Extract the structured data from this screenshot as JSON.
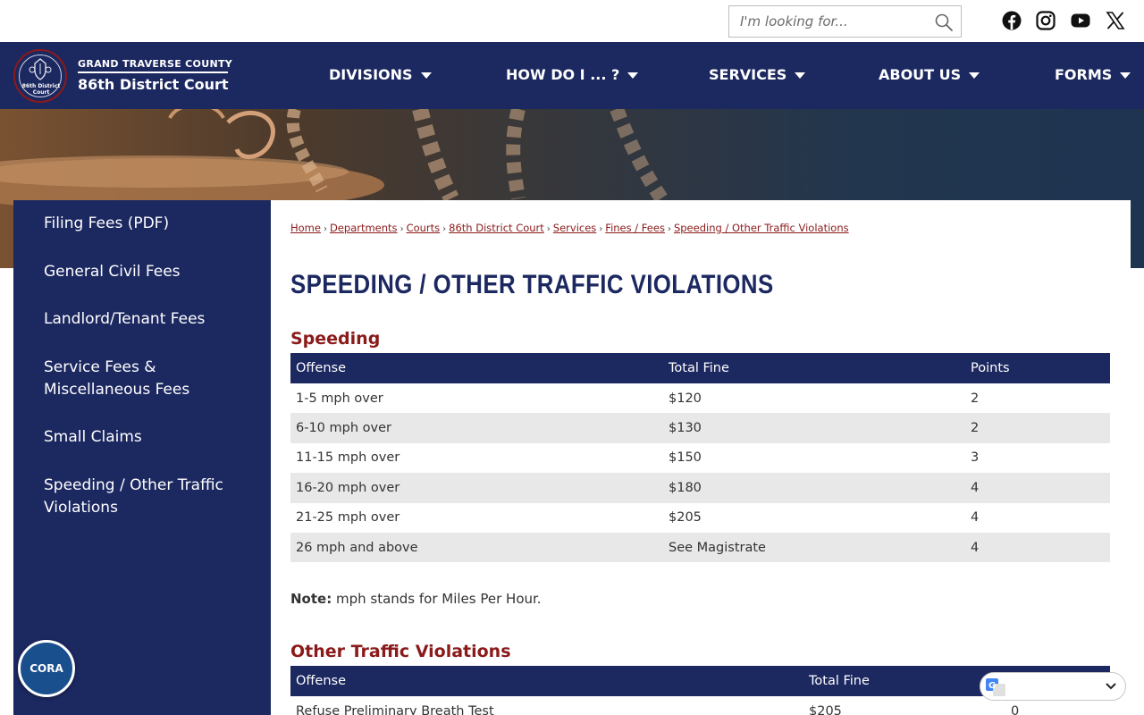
{
  "search": {
    "placeholder": "I'm looking for..."
  },
  "social": [
    "facebook-icon",
    "instagram-icon",
    "youtube-icon",
    "x-icon"
  ],
  "site": {
    "county": "GRAND TRAVERSE COUNTY",
    "court": "86th District Court",
    "seal_text": "86th District Court"
  },
  "nav": {
    "items": [
      "DIVISIONS",
      "HOW DO I ... ?",
      "SERVICES",
      "ABOUT US",
      "FORMS"
    ]
  },
  "sidebar": {
    "items": [
      "Filing Fees (PDF)",
      "General Civil Fees",
      "Landlord/Tenant Fees",
      "Service Fees & Miscellaneous Fees",
      "Small Claims",
      "Speeding / Other Traffic Violations"
    ]
  },
  "breadcrumb": [
    "Home",
    "Departments",
    "Courts",
    "86th District Court",
    "Services",
    "Fines / Fees",
    "Speeding / Other Traffic Violations"
  ],
  "page_title": "SPEEDING / OTHER TRAFFIC VIOLATIONS",
  "speeding": {
    "heading": "Speeding",
    "columns": [
      "Offense",
      "Total Fine",
      "Points"
    ],
    "rows": [
      [
        "1-5 mph over",
        "$120",
        "2"
      ],
      [
        "6-10 mph over",
        "$130",
        "2"
      ],
      [
        "11-15 mph over",
        "$150",
        "3"
      ],
      [
        "16-20 mph over",
        "$180",
        "4"
      ],
      [
        "21-25 mph over",
        "$205",
        "4"
      ],
      [
        "26 mph and above",
        "See Magistrate",
        "4"
      ]
    ]
  },
  "note": {
    "label": "Note:",
    "text": " mph stands for Miles Per Hour."
  },
  "other": {
    "heading": "Other Traffic Violations",
    "columns": [
      "Offense",
      "Total Fine",
      ""
    ],
    "rows": [
      [
        "Refuse Preliminary Breath Test",
        "$205",
        "0"
      ]
    ]
  },
  "cora_label": "CORA",
  "colors": {
    "navy": "#1c2860",
    "maroon": "#8b1a1a",
    "row_shade": "#e8e8e8"
  }
}
